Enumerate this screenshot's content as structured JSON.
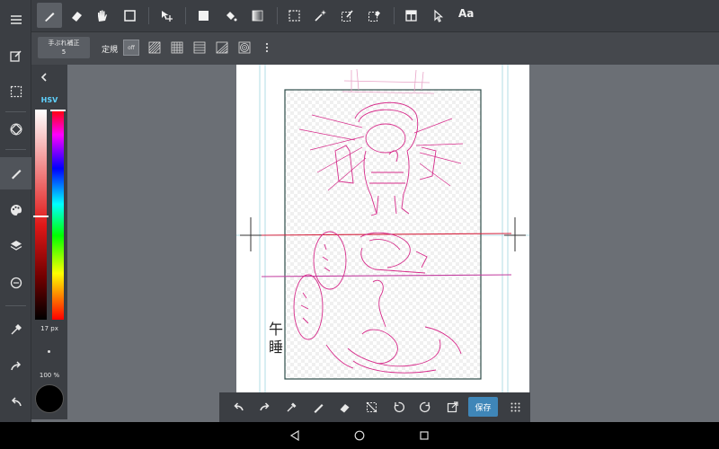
{
  "toolbar": {
    "tools": [
      "pen-tool",
      "eraser-tool",
      "hand-tool",
      "shape-tool",
      "move-tool",
      "fill-tool",
      "bucket-tool",
      "gradient-tool",
      "select-tool",
      "magic-wand-tool",
      "select-pen-tool",
      "select-eraser-tool",
      "frame-tool",
      "operation-tool"
    ],
    "text_tool_label": "Aa"
  },
  "subbar": {
    "stabilizer_label": "手ぶれ補正",
    "stabilizer_value": "5",
    "ruler_label": "定規",
    "ruler_off_label": "off"
  },
  "color_panel": {
    "mode_label": "HSV",
    "brush_size": "17 px",
    "opacity": "100 %",
    "current_color": "#000000"
  },
  "canvas": {
    "title_text_line1": "午",
    "title_text_line2": "睡",
    "sketch_color": "#d62b8a",
    "frame_color": "#2e4d4a"
  },
  "quickbar": {
    "save_label": "保存"
  },
  "colors": {
    "accent": "#3f86b8",
    "hsv_label": "#5fd3ff"
  }
}
